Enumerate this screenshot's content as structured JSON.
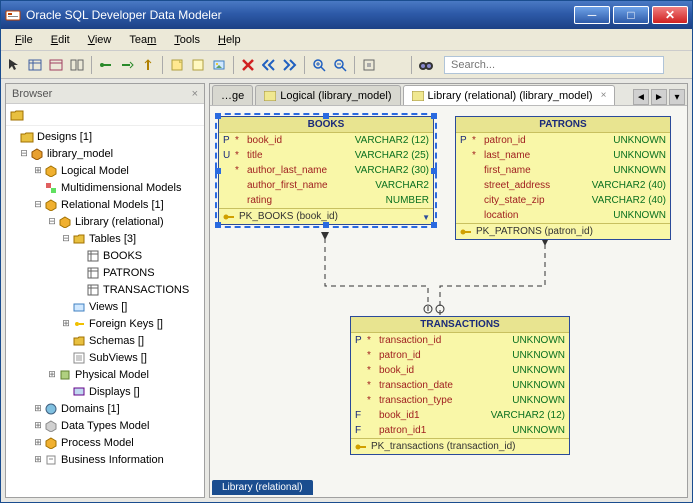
{
  "title": "Oracle SQL Developer Data Modeler",
  "menus": [
    "File",
    "Edit",
    "View",
    "Team",
    "Tools",
    "Help"
  ],
  "search_placeholder": "Search...",
  "browser": {
    "title": "Browser",
    "root": "Designs [1]",
    "items": {
      "library_model": "library_model",
      "logical_model": "Logical Model",
      "multidimensional": "Multidimensional Models",
      "relational_models": "Relational Models [1]",
      "library_relational": "Library (relational)",
      "tables": "Tables [3]",
      "books": "BOOKS",
      "patrons": "PATRONS",
      "transactions": "TRANSACTIONS",
      "views": "Views []",
      "foreign_keys": "Foreign Keys []",
      "schemas": "Schemas []",
      "subviews": "SubViews []",
      "physical_model": "Physical Model",
      "displays": "Displays []",
      "domains": "Domains [1]",
      "data_types": "Data Types Model",
      "process_model": "Process Model",
      "business_info": "Business Information"
    }
  },
  "tabs": {
    "t0": "…ge",
    "t1": "Logical (library_model)",
    "t2": "Library (relational) (library_model)"
  },
  "status_tab": "Library (relational)",
  "entities": {
    "books": {
      "title": "BOOKS",
      "rows": [
        {
          "flag": "P",
          "star": "*",
          "name": "book_id",
          "type": "VARCHAR2 (12)"
        },
        {
          "flag": "U",
          "star": "*",
          "name": "title",
          "type": "VARCHAR2 (25)"
        },
        {
          "flag": "",
          "star": "*",
          "name": "author_last_name",
          "type": "VARCHAR2 (30)"
        },
        {
          "flag": "",
          "star": "",
          "name": "author_first_name",
          "type": "VARCHAR2"
        },
        {
          "flag": "",
          "star": "",
          "name": "rating",
          "type": "NUMBER"
        }
      ],
      "pk": "PK_BOOKS (book_id)"
    },
    "patrons": {
      "title": "PATRONS",
      "rows": [
        {
          "flag": "P",
          "star": "*",
          "name": "patron_id",
          "type": "UNKNOWN"
        },
        {
          "flag": "",
          "star": "*",
          "name": "last_name",
          "type": "UNKNOWN"
        },
        {
          "flag": "",
          "star": "",
          "name": "first_name",
          "type": "UNKNOWN"
        },
        {
          "flag": "",
          "star": "",
          "name": "street_address",
          "type": "VARCHAR2 (40)"
        },
        {
          "flag": "",
          "star": "",
          "name": "city_state_zip",
          "type": "VARCHAR2 (40)"
        },
        {
          "flag": "",
          "star": "",
          "name": "location",
          "type": "UNKNOWN"
        }
      ],
      "pk": "PK_PATRONS (patron_id)"
    },
    "transactions": {
      "title": "TRANSACTIONS",
      "rows": [
        {
          "flag": "P",
          "star": "*",
          "name": "transaction_id",
          "type": "UNKNOWN"
        },
        {
          "flag": "",
          "star": "*",
          "name": "patron_id",
          "type": "UNKNOWN"
        },
        {
          "flag": "",
          "star": "*",
          "name": "book_id",
          "type": "UNKNOWN"
        },
        {
          "flag": "",
          "star": "*",
          "name": "transaction_date",
          "type": "UNKNOWN"
        },
        {
          "flag": "",
          "star": "*",
          "name": "transaction_type",
          "type": "UNKNOWN"
        },
        {
          "flag": "F",
          "star": "",
          "name": "book_id1",
          "type": "VARCHAR2 (12)"
        },
        {
          "flag": "F",
          "star": "",
          "name": "patron_id1",
          "type": "UNKNOWN"
        }
      ],
      "pk": "PK_transactions (transaction_id)"
    }
  }
}
